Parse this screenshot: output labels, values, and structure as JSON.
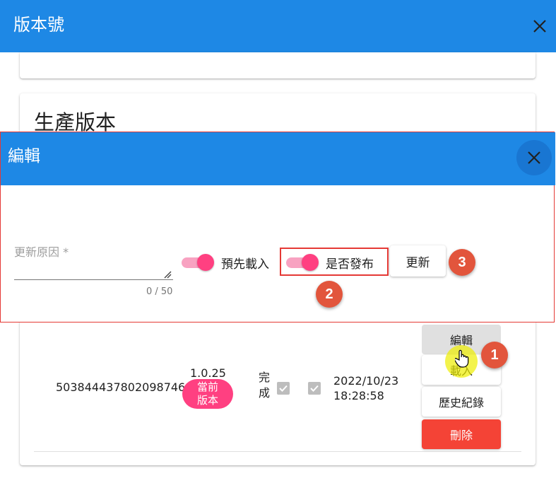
{
  "window": {
    "title": "版本號"
  },
  "section": {
    "heading": "生產版本"
  },
  "dialog": {
    "title": "編輯",
    "reason_label": "更新原因 *",
    "counter": "0 / 50",
    "preload_label": "預先載入",
    "publish_label": "是否發布",
    "preload_on": true,
    "publish_on": true,
    "update_label": "更新"
  },
  "row": {
    "id": "503844437802098746",
    "version": "1.0.25",
    "badge": "當前版本",
    "status": "完成",
    "date_line1": "2022/10/23",
    "date_line2": "18:28:58",
    "edit_label": "編輯",
    "load_label": "載入",
    "history_label": "歷史紀錄",
    "delete_label": "刪除"
  },
  "markers": [
    "1",
    "2",
    "3"
  ],
  "colors": {
    "primary": "#1e88e5",
    "accent": "#ff4081",
    "delete": "#f44336",
    "marker": "#e2553c",
    "highlight": "#e53935"
  },
  "icons": {
    "close": "close-icon",
    "check": "check-icon",
    "cursor": "hand-pointer-icon"
  }
}
